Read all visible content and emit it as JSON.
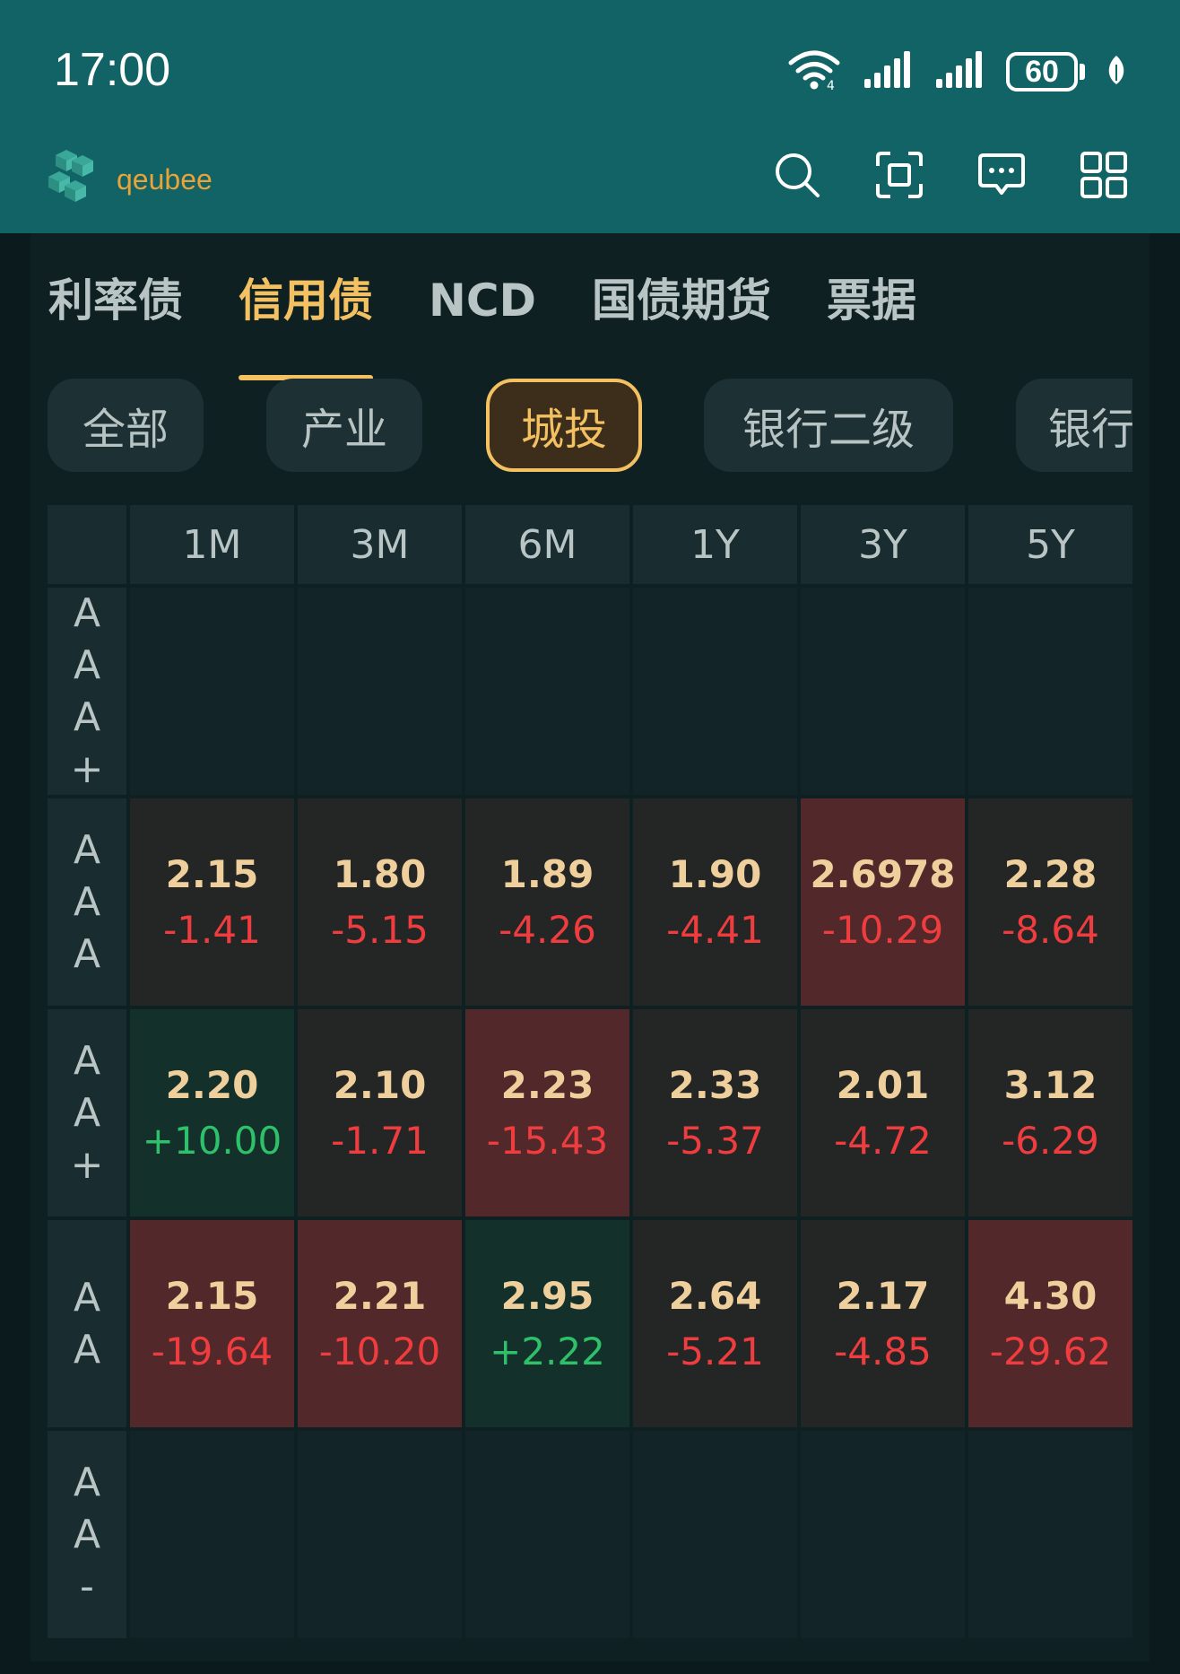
{
  "status_bar": {
    "time": "17:00",
    "battery": "60"
  },
  "brand": {
    "name": "qeubee"
  },
  "tabs": [
    {
      "label": "利率债",
      "active": false
    },
    {
      "label": "信用债",
      "active": true
    },
    {
      "label": "NCD",
      "active": false
    },
    {
      "label": "国债期货",
      "active": false
    },
    {
      "label": "票据",
      "active": false
    }
  ],
  "filters": [
    {
      "label": "全部",
      "active": false
    },
    {
      "label": "产业",
      "active": false
    },
    {
      "label": "城投",
      "active": true
    },
    {
      "label": "银行二级",
      "active": false
    },
    {
      "label": "银行",
      "active": false
    }
  ],
  "table": {
    "columns": [
      "1M",
      "3M",
      "6M",
      "1Y",
      "3Y",
      "5Y"
    ],
    "rows": [
      {
        "rating": [
          "A",
          "A",
          "A",
          "+"
        ],
        "cells": [
          null,
          null,
          null,
          null,
          null,
          null
        ]
      },
      {
        "rating": [
          "A",
          "A",
          "A"
        ],
        "cells": [
          {
            "rate": "2.15",
            "change": "-1.41",
            "tone": "neutral"
          },
          {
            "rate": "1.80",
            "change": "-5.15",
            "tone": "neutral"
          },
          {
            "rate": "1.89",
            "change": "-4.26",
            "tone": "neutral"
          },
          {
            "rate": "1.90",
            "change": "-4.41",
            "tone": "neutral"
          },
          {
            "rate": "2.6978",
            "change": "-10.29",
            "tone": "red"
          },
          {
            "rate": "2.28",
            "change": "-8.64",
            "tone": "neutral"
          }
        ]
      },
      {
        "rating": [
          "A",
          "A",
          "+"
        ],
        "cells": [
          {
            "rate": "2.20",
            "change": "+10.00",
            "tone": "green"
          },
          {
            "rate": "2.10",
            "change": "-1.71",
            "tone": "neutral"
          },
          {
            "rate": "2.23",
            "change": "-15.43",
            "tone": "red"
          },
          {
            "rate": "2.33",
            "change": "-5.37",
            "tone": "neutral"
          },
          {
            "rate": "2.01",
            "change": "-4.72",
            "tone": "neutral"
          },
          {
            "rate": "3.12",
            "change": "-6.29",
            "tone": "neutral"
          }
        ]
      },
      {
        "rating": [
          "A",
          "A"
        ],
        "cells": [
          {
            "rate": "2.15",
            "change": "-19.64",
            "tone": "red"
          },
          {
            "rate": "2.21",
            "change": "-10.20",
            "tone": "red"
          },
          {
            "rate": "2.95",
            "change": "+2.22",
            "tone": "green"
          },
          {
            "rate": "2.64",
            "change": "-5.21",
            "tone": "neutral"
          },
          {
            "rate": "2.17",
            "change": "-4.85",
            "tone": "neutral"
          },
          {
            "rate": "4.30",
            "change": "-29.62",
            "tone": "red"
          }
        ]
      },
      {
        "rating": [
          "A",
          "A",
          "-"
        ],
        "cells": [
          null,
          null,
          null,
          null,
          null,
          null
        ]
      }
    ]
  },
  "colors": {
    "header_bg": "#126365",
    "accent": "#f3c161",
    "negative": "#ef3c3f",
    "positive": "#2fc06a",
    "cell_red": "#52282a",
    "cell_green": "#13312a"
  },
  "icons": [
    "wifi-icon",
    "signal-icon",
    "battery-icon",
    "leaf-icon",
    "search-icon",
    "scan-icon",
    "message-icon",
    "grid-menu-icon"
  ]
}
